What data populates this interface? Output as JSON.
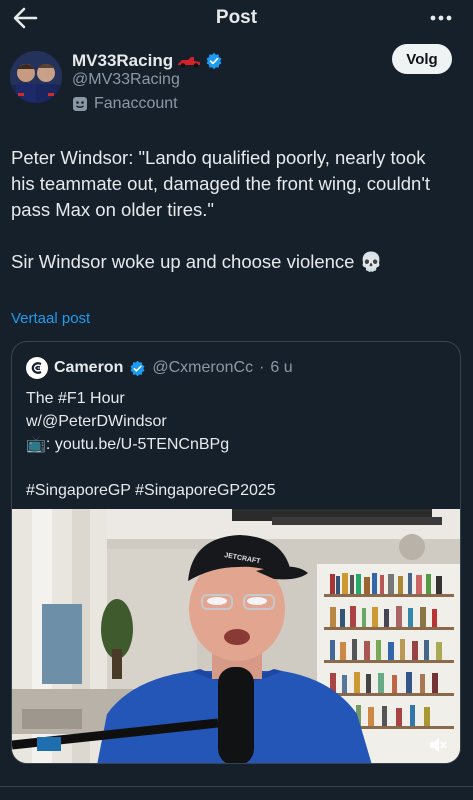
{
  "header": {
    "title": "Post",
    "back_icon": "arrow-left-icon",
    "more_icon": "more-horizontal-icon"
  },
  "author": {
    "name": "MV33Racing",
    "handle": "@MV33Racing",
    "label": "Fanaccount",
    "verified_color": "#1d9bf0"
  },
  "follow_label": "Volg",
  "tweet": {
    "line1": "Peter Windsor: \"Lando qualified poorly, nearly took his teammate out, damaged the front wing, couldn't pass Max on older tires.\"",
    "line2": "Sir Windsor woke up and choose violence 💀"
  },
  "translate_label": "Vertaal post",
  "quote": {
    "name": "Cameron",
    "handle": "@CxmeronCc",
    "separator": "·",
    "time": "6 u",
    "line1": "The #F1 Hour",
    "line2": "w/@PeterDWindsor",
    "line3": "📺: youtu.be/U-5TENCnBPg",
    "line4": "#SingaporeGP #SingaporeGP2025",
    "media_cap_text": "JETCRAFT"
  },
  "colors": {
    "background": "#15202b",
    "accent": "#1d9bf0",
    "muted": "#8b98a5"
  }
}
